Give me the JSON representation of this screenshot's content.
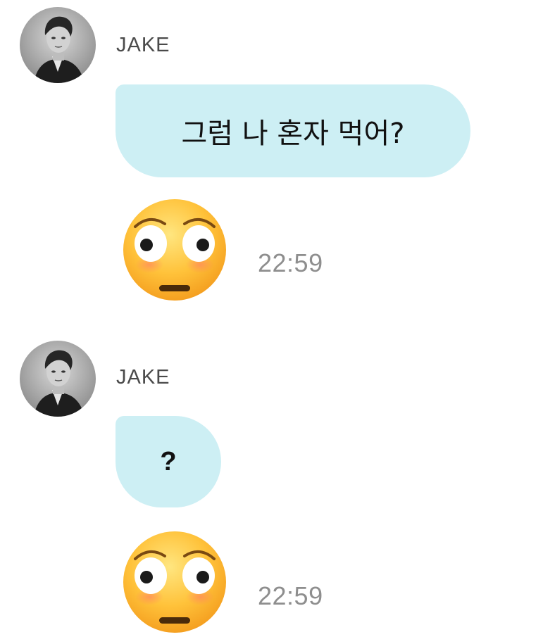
{
  "messages": [
    {
      "sender": "JAKE",
      "text": "그럼 나 혼자 먹어?",
      "emoji": "flushed-face-icon",
      "time": "22:59"
    },
    {
      "sender": "JAKE",
      "text": "?",
      "emoji": "flushed-face-icon",
      "time": "22:59"
    }
  ],
  "colors": {
    "bubble": "#cdeff4",
    "sender": "#4a4a4a",
    "time": "#8e8e8e"
  }
}
